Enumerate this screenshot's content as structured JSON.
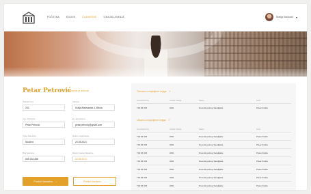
{
  "nav": {
    "items": [
      "Početna",
      "Knjige",
      "Članarine",
      "Iznajmljivanja"
    ],
    "active_index": 2
  },
  "user": {
    "name": "Marija Vasković"
  },
  "profile": {
    "name": "Petar Petrović",
    "member_label": "Članarina je aktivna",
    "fields": [
      {
        "label": "Članski broj",
        "value": "202"
      },
      {
        "label": "Adresa",
        "value": "Kralja Aleksandra 1, Bitola"
      },
      {
        "label": "Ime i Prezime",
        "value": "Petar Petrović"
      },
      {
        "label": "E-mail adresa",
        "value": "petar.petrovic@gmail.com"
      },
      {
        "label": "Vrsta članarine",
        "value": "Student"
      },
      {
        "label": "Datum registracije",
        "value": "20.05.2021"
      },
      {
        "label": "Broj telefona",
        "value": "069 234 458"
      },
      {
        "label": "Datum isteka članarine",
        "value": "20.05.2021"
      }
    ],
    "primary_button": "Produži članarinu",
    "outline_button": "Prekini članarinu"
  },
  "lists": [
    {
      "title": "Trenutno iznajmljene knjige",
      "count": "1",
      "columns": [
        "Inventarski broj",
        "Godina izdanja",
        "Naslov",
        "Autor"
      ],
      "rows": [
        [
          "T32 96 345",
          "2001",
          "Dnevnik jednog Sarajlijaka",
          "Pavle Kraštu"
        ]
      ]
    },
    {
      "title": "Ukupno iznajmljenih knjiga",
      "count": "7",
      "columns": [
        "Inventarski broj",
        "Godina izdanja",
        "Naslov",
        "Autor"
      ],
      "rows": [
        [
          "T32 96 345",
          "2001",
          "Dnevnik jednog Sarajlijaka",
          "Pavle Kraštu"
        ],
        [
          "T32 96 345",
          "2001",
          "Dnevnik jednog Sarajlijaka",
          "Pavle Kraštu"
        ],
        [
          "T32 96 345",
          "2001",
          "Dnevnik jednog Sarajlijaka",
          "Pavle Kraštu"
        ],
        [
          "T32 96 345",
          "2001",
          "Dnevnik jednog Sarajlijaka",
          "Pavle Kraštu"
        ],
        [
          "T32 96 345",
          "2001",
          "Dnevnik jednog Sarajlijaka",
          "Pavle Kraštu"
        ],
        [
          "T32 96 345",
          "2001",
          "Dnevnik jednog Sarajlijaka",
          "Pavle Kraštu"
        ],
        [
          "T32 96 345",
          "2001",
          "Dnevnik jednog Sarajlijaka",
          "Pavle Kraštu"
        ]
      ]
    }
  ],
  "colors": {
    "accent": "#e3a12a",
    "panel": "#f6f6f6"
  },
  "icons": {
    "logo": "library-building-icon",
    "chevron": "chevron-down-icon",
    "arrow": "arrow-right-icon"
  }
}
